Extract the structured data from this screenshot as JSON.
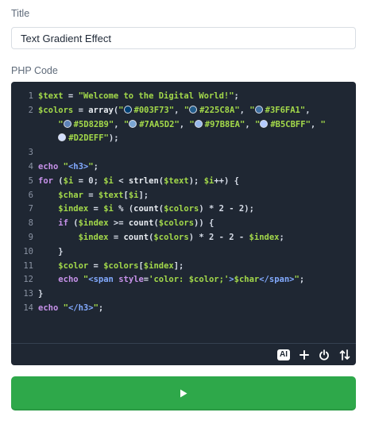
{
  "form": {
    "title_label": "Title",
    "title_value": "Text Gradient Effect",
    "code_label": "PHP Code"
  },
  "editor": {
    "lines": [
      {
        "n": "1",
        "tokens": [
          {
            "c": "var",
            "t": "$text"
          },
          {
            "c": "op",
            "t": " = "
          },
          {
            "c": "str",
            "t": "\"Welcome to the Digital World!\""
          },
          {
            "c": "op",
            "t": ";"
          }
        ]
      },
      {
        "n": "2",
        "tokens": [
          {
            "c": "var",
            "t": "$colors"
          },
          {
            "c": "op",
            "t": " = "
          },
          {
            "c": "fn",
            "t": "array"
          },
          {
            "c": "op",
            "t": "("
          },
          {
            "c": "str",
            "t": "\""
          },
          {
            "c": "swatch",
            "color": "#003F73"
          },
          {
            "c": "str",
            "t": "#003F73\""
          },
          {
            "c": "op",
            "t": ", "
          },
          {
            "c": "str",
            "t": "\""
          },
          {
            "c": "swatch",
            "color": "#225C8A"
          },
          {
            "c": "str",
            "t": "#225C8A\""
          },
          {
            "c": "op",
            "t": ", "
          },
          {
            "c": "str",
            "t": "\""
          },
          {
            "c": "swatch",
            "color": "#3F6FA1"
          },
          {
            "c": "str",
            "t": "#3F6FA1\""
          },
          {
            "c": "op",
            "t": ","
          }
        ]
      },
      {
        "n": "",
        "tokens": [
          {
            "c": "op",
            "t": "    "
          },
          {
            "c": "str",
            "t": "\""
          },
          {
            "c": "swatch",
            "color": "#5D82B9"
          },
          {
            "c": "str",
            "t": "#5D82B9\""
          },
          {
            "c": "op",
            "t": ", "
          },
          {
            "c": "str",
            "t": "\""
          },
          {
            "c": "swatch",
            "color": "#7AA5D2"
          },
          {
            "c": "str",
            "t": "#7AA5D2\""
          },
          {
            "c": "op",
            "t": ", "
          },
          {
            "c": "str",
            "t": "\""
          },
          {
            "c": "swatch",
            "color": "#97B8EA"
          },
          {
            "c": "str",
            "t": "#97B8EA\""
          },
          {
            "c": "op",
            "t": ", "
          },
          {
            "c": "str",
            "t": "\""
          },
          {
            "c": "swatch",
            "color": "#B5CBFF"
          },
          {
            "c": "str",
            "t": "#B5CBFF\""
          },
          {
            "c": "op",
            "t": ", "
          },
          {
            "c": "str",
            "t": "\""
          }
        ]
      },
      {
        "n": "",
        "tokens": [
          {
            "c": "op",
            "t": "    "
          },
          {
            "c": "swatch",
            "color": "#D2DEFF"
          },
          {
            "c": "str",
            "t": "#D2DEFF\""
          },
          {
            "c": "op",
            "t": ");"
          }
        ]
      },
      {
        "n": "3",
        "tokens": []
      },
      {
        "n": "4",
        "tokens": [
          {
            "c": "kw",
            "t": "echo"
          },
          {
            "c": "op",
            "t": " "
          },
          {
            "c": "str",
            "t": "\""
          },
          {
            "c": "tag",
            "t": "<h3>"
          },
          {
            "c": "str",
            "t": "\""
          },
          {
            "c": "op",
            "t": ";"
          }
        ]
      },
      {
        "n": "5",
        "tokens": [
          {
            "c": "kw",
            "t": "for"
          },
          {
            "c": "op",
            "t": " ("
          },
          {
            "c": "var",
            "t": "$i"
          },
          {
            "c": "op",
            "t": " = 0; "
          },
          {
            "c": "var",
            "t": "$i"
          },
          {
            "c": "op",
            "t": " < "
          },
          {
            "c": "fn",
            "t": "strlen"
          },
          {
            "c": "op",
            "t": "("
          },
          {
            "c": "var",
            "t": "$text"
          },
          {
            "c": "op",
            "t": "); "
          },
          {
            "c": "var",
            "t": "$i"
          },
          {
            "c": "op",
            "t": "++) {"
          }
        ]
      },
      {
        "n": "6",
        "tokens": [
          {
            "c": "op",
            "t": "    "
          },
          {
            "c": "var",
            "t": "$char"
          },
          {
            "c": "op",
            "t": " = "
          },
          {
            "c": "var",
            "t": "$text"
          },
          {
            "c": "op",
            "t": "["
          },
          {
            "c": "var",
            "t": "$i"
          },
          {
            "c": "op",
            "t": "];"
          }
        ]
      },
      {
        "n": "7",
        "tokens": [
          {
            "c": "op",
            "t": "    "
          },
          {
            "c": "var",
            "t": "$index"
          },
          {
            "c": "op",
            "t": " = "
          },
          {
            "c": "var",
            "t": "$i"
          },
          {
            "c": "op",
            "t": " % ("
          },
          {
            "c": "fn",
            "t": "count"
          },
          {
            "c": "op",
            "t": "("
          },
          {
            "c": "var",
            "t": "$colors"
          },
          {
            "c": "op",
            "t": ") * 2 - 2);"
          }
        ]
      },
      {
        "n": "8",
        "tokens": [
          {
            "c": "op",
            "t": "    "
          },
          {
            "c": "kw",
            "t": "if"
          },
          {
            "c": "op",
            "t": " ("
          },
          {
            "c": "var",
            "t": "$index"
          },
          {
            "c": "op",
            "t": " >= "
          },
          {
            "c": "fn",
            "t": "count"
          },
          {
            "c": "op",
            "t": "("
          },
          {
            "c": "var",
            "t": "$colors"
          },
          {
            "c": "op",
            "t": ")) {"
          }
        ]
      },
      {
        "n": "9",
        "tokens": [
          {
            "c": "op",
            "t": "        "
          },
          {
            "c": "var",
            "t": "$index"
          },
          {
            "c": "op",
            "t": " = "
          },
          {
            "c": "fn",
            "t": "count"
          },
          {
            "c": "op",
            "t": "("
          },
          {
            "c": "var",
            "t": "$colors"
          },
          {
            "c": "op",
            "t": ") * 2 - 2 - "
          },
          {
            "c": "var",
            "t": "$index"
          },
          {
            "c": "op",
            "t": ";"
          }
        ]
      },
      {
        "n": "10",
        "tokens": [
          {
            "c": "op",
            "t": "    }"
          }
        ]
      },
      {
        "n": "11",
        "tokens": [
          {
            "c": "op",
            "t": "    "
          },
          {
            "c": "var",
            "t": "$color"
          },
          {
            "c": "op",
            "t": " = "
          },
          {
            "c": "var",
            "t": "$colors"
          },
          {
            "c": "op",
            "t": "["
          },
          {
            "c": "var",
            "t": "$index"
          },
          {
            "c": "op",
            "t": "];"
          }
        ]
      },
      {
        "n": "12",
        "tokens": [
          {
            "c": "op",
            "t": "    "
          },
          {
            "c": "kw",
            "t": "echo"
          },
          {
            "c": "op",
            "t": " "
          },
          {
            "c": "str",
            "t": "\""
          },
          {
            "c": "tag",
            "t": "<span "
          },
          {
            "c": "kw",
            "t": "style"
          },
          {
            "c": "op",
            "t": "="
          },
          {
            "c": "str",
            "t": "'color: "
          },
          {
            "c": "var",
            "t": "$color"
          },
          {
            "c": "str",
            "t": ";'"
          },
          {
            "c": "tag",
            "t": ">"
          },
          {
            "c": "var",
            "t": "$char"
          },
          {
            "c": "tag",
            "t": "</span>"
          },
          {
            "c": "str",
            "t": "\""
          },
          {
            "c": "op",
            "t": ";"
          }
        ]
      },
      {
        "n": "13",
        "tokens": [
          {
            "c": "op",
            "t": "}"
          }
        ]
      },
      {
        "n": "14",
        "tokens": [
          {
            "c": "kw",
            "t": "echo"
          },
          {
            "c": "op",
            "t": " "
          },
          {
            "c": "str",
            "t": "\""
          },
          {
            "c": "tag",
            "t": "</h3>"
          },
          {
            "c": "str",
            "t": "\""
          },
          {
            "c": "op",
            "t": ";"
          }
        ]
      }
    ],
    "toolbar": {
      "ai_label": "AI",
      "add_icon": "plus-icon",
      "power_icon": "power-icon",
      "sort_icon": "sort-arrows-icon"
    }
  },
  "run_button": {
    "icon": "play-icon"
  },
  "colors": {
    "editor_bg": "#1f2733",
    "run_green": "#2ea84a",
    "variable_green": "#a3d94a",
    "keyword_purple": "#c792ea",
    "tag_blue": "#82aaff"
  }
}
